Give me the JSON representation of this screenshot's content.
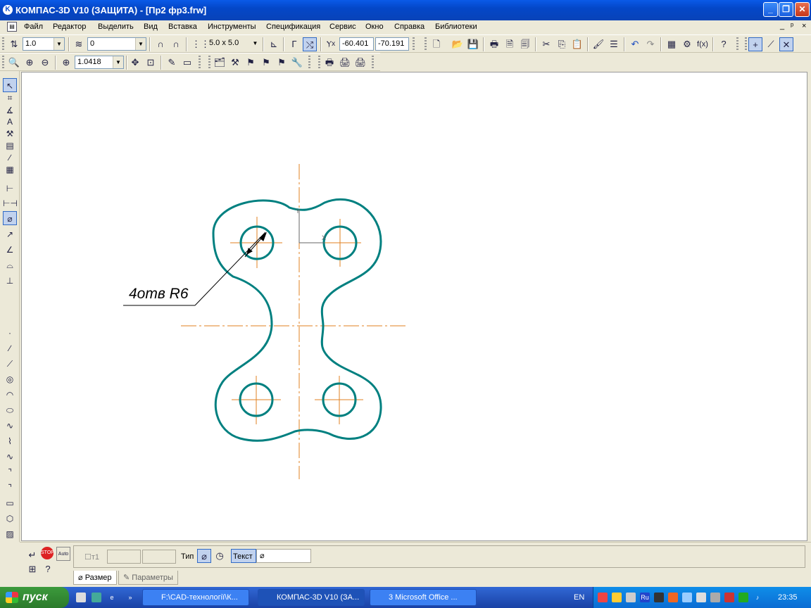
{
  "window": {
    "title": "КОМПАС-3D V10 (ЗАЩИТА) - [Пр2 фр3.frw]",
    "app_icon": "K",
    "minimize": "_",
    "restore": "❐",
    "close": "✕"
  },
  "menu": {
    "items": [
      "Файл",
      "Редактор",
      "Выделить",
      "Вид",
      "Вставка",
      "Инструменты",
      "Спецификация",
      "Сервис",
      "Окно",
      "Справка",
      "Библиотеки"
    ],
    "mdi_min": "_",
    "mdi_restore": "ᵖ",
    "mdi_close": "×"
  },
  "toolbar1": {
    "step": "1.0",
    "layer": "0",
    "grid": "5.0 x 5.0",
    "coord_x": "-60.401",
    "coord_y": "-70.191"
  },
  "toolbar2": {
    "zoom": "1.0418"
  },
  "drawing": {
    "annotation": "4отв R6",
    "colors": {
      "contour": "#008080",
      "axis": "#e08020",
      "leader": "#000000"
    }
  },
  "props": {
    "t1_label": "т1",
    "type_label": "Тип",
    "text_label": "Текст",
    "text_value": "⌀",
    "tabs": [
      "Размер",
      "Параметры"
    ]
  },
  "taskbar": {
    "start": "пуск",
    "tasks": [
      "F:\\CAD-технології\\К...",
      "КОМПАС-3D V10 (ЗА...",
      "3 Microsoft Office ..."
    ],
    "lang": "EN",
    "clock": "23:35"
  }
}
